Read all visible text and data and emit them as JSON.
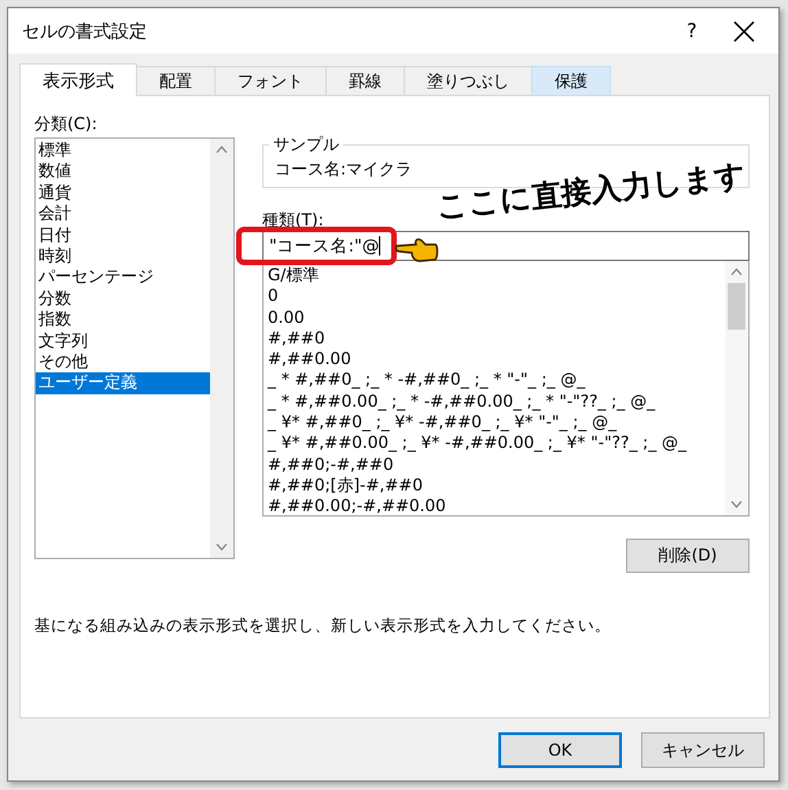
{
  "window": {
    "title": "セルの書式設定",
    "help": "?"
  },
  "tabs": [
    {
      "label": "表示形式",
      "selected": true,
      "hovered": false
    },
    {
      "label": "配置",
      "selected": false,
      "hovered": false
    },
    {
      "label": "フォント",
      "selected": false,
      "hovered": false
    },
    {
      "label": "罫線",
      "selected": false,
      "hovered": false
    },
    {
      "label": "塗りつぶし",
      "selected": false,
      "hovered": false
    },
    {
      "label": "保護",
      "selected": false,
      "hovered": true
    }
  ],
  "category": {
    "label": "分類(C):",
    "items": [
      {
        "label": "標準",
        "selected": false
      },
      {
        "label": "数値",
        "selected": false
      },
      {
        "label": "通貨",
        "selected": false
      },
      {
        "label": "会計",
        "selected": false
      },
      {
        "label": "日付",
        "selected": false
      },
      {
        "label": "時刻",
        "selected": false
      },
      {
        "label": "パーセンテージ",
        "selected": false
      },
      {
        "label": "分数",
        "selected": false
      },
      {
        "label": "指数",
        "selected": false
      },
      {
        "label": "文字列",
        "selected": false
      },
      {
        "label": "その他",
        "selected": false
      },
      {
        "label": "ユーザー定義",
        "selected": true
      }
    ]
  },
  "sample": {
    "label": "サンプル",
    "value": "コース名:マイクラ"
  },
  "type": {
    "label": "種類(T):",
    "value": "\"コース名:\"@"
  },
  "formats": [
    "G/標準",
    "0",
    "0.00",
    "#,##0",
    "#,##0.00",
    "_ * #,##0_ ;_ * -#,##0_ ;_ * \"-\"_ ;_ @_",
    "_ * #,##0.00_ ;_ * -#,##0.00_ ;_ * \"-\"??_ ;_ @_",
    "_ ¥* #,##0_ ;_ ¥* -#,##0_ ;_ ¥* \"-\"_ ;_ @_",
    "_ ¥* #,##0.00_ ;_ ¥* -#,##0.00_ ;_ ¥* \"-\"??_ ;_ @_",
    "#,##0;-#,##0",
    "#,##0;[赤]-#,##0",
    "#,##0.00;-#,##0.00"
  ],
  "delete_button": "削除(D)",
  "description": "基になる組み込みの表示形式を選択し、新しい表示形式を入力してください。",
  "buttons": [
    {
      "label": "OK",
      "default": true
    },
    {
      "label": "キャンセル",
      "default": false
    }
  ],
  "annotation": {
    "text": "ここに直接入力します"
  }
}
